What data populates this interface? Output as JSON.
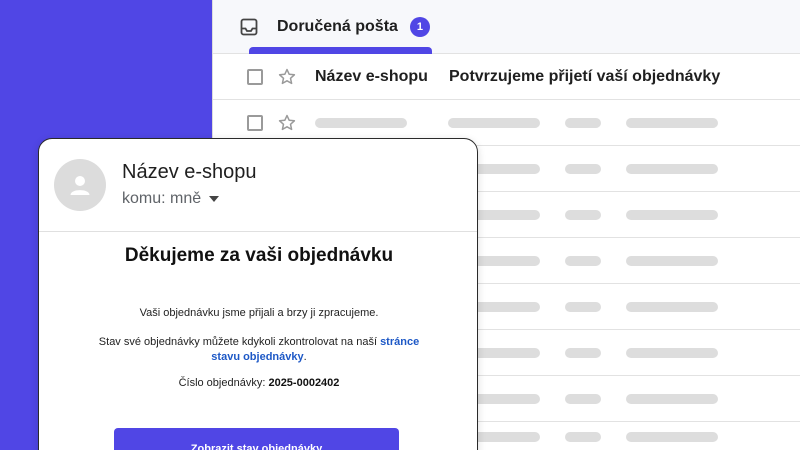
{
  "inbox": {
    "tab_label": "Doručená pošta",
    "unread_count": "1",
    "accent": "#5046e5",
    "rows": [
      {
        "sender": "Název e-shopu",
        "subject": "Potvrzujeme přijetí vaší objednávky"
      }
    ],
    "icons": {
      "inbox": "inbox-tray-icon",
      "star": "star-outline-icon"
    }
  },
  "email": {
    "from_name": "Název e-shopu",
    "to_label": "komu: mně",
    "title": "Děkujeme za vaši objednávku",
    "body_line1": "Vaši objednávku jsme přijali a brzy ji zpracujeme.",
    "body_line2_prefix": "Stav své objednávky můžete kdykoli zkontrolovat na naší ",
    "body_line2_link": "stránce stavu objednávky",
    "body_line2_suffix": ".",
    "order_label": "Číslo objednávky: ",
    "order_number": "2025-0002402",
    "cta_label": "Zobrazit stav objednávky",
    "icons": {
      "avatar": "person-avatar-icon",
      "caret": "chevron-down-icon"
    }
  }
}
